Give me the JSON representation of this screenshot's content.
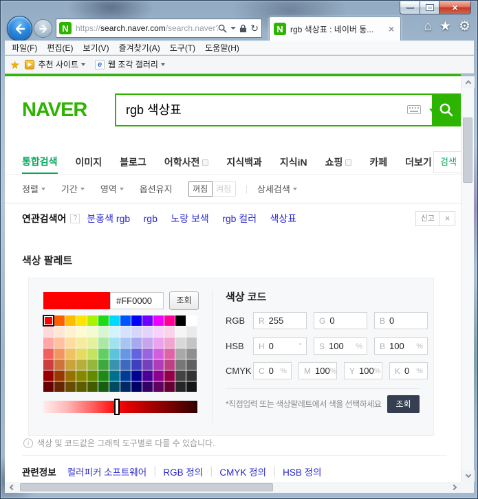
{
  "browser": {
    "tab_title": "rgb 색상표 : 네이버 통...",
    "favicon_letter": "N",
    "url": {
      "scheme": "https://",
      "host": "search.naver.com",
      "path": "/search.naver?"
    }
  },
  "menu": {
    "items": [
      "파일(F)",
      "편집(E)",
      "보기(V)",
      "즐겨찾기(A)",
      "도구(T)",
      "도움말(H)"
    ]
  },
  "favbar": {
    "suggested_sites": "추천 사이트",
    "web_slices": "웹 조각 갤러리"
  },
  "header": {
    "logo": "NAVER",
    "query": "rgb 색상표"
  },
  "tabs": {
    "items": [
      "통합검색",
      "이미지",
      "블로그",
      "어학사전",
      "지식백과",
      "지식iN",
      "쇼핑",
      "카페",
      "더보기"
    ],
    "active": "통합검색",
    "side_button": "검색"
  },
  "filters": {
    "sort": "정렬",
    "period": "기간",
    "scope": "영역",
    "keep_option": "옵션유지",
    "off": "꺼짐",
    "on": "켜짐",
    "advanced": "상세검색"
  },
  "related": {
    "label": "연관검색어",
    "help": "?",
    "terms": [
      "분홍색 rgb",
      "rgb",
      "노랑 보색",
      "rgb 컬러",
      "색상표"
    ],
    "report": "신고"
  },
  "palette": {
    "section_title": "색상 팔레트",
    "hex": "#FF0000",
    "lookup": "조회",
    "selected_row": 0,
    "selected_col": 0,
    "slider_pct": 48,
    "grid": [
      [
        "#FF0000",
        "#FF5E00",
        "#FFBB00",
        "#FFE400",
        "#ABF200",
        "#1DDB16",
        "#00D8FF",
        "#0054FF",
        "#0100FF",
        "#6F00FF",
        "#EB00FF",
        "#FF0095",
        "#000000",
        "#FFFFFF"
      ],
      [
        "#FFD8D8",
        "#FFE6D5",
        "#FFF2D1",
        "#FFFBD1",
        "#F2FBD1",
        "#D8F5D2",
        "#D2F3FB",
        "#D4E3FB",
        "#D6D6FB",
        "#E3D4FB",
        "#F7D2FB",
        "#FBD2EA",
        "#F5F5F5",
        "#EAEAEA"
      ],
      [
        "#FFA7A7",
        "#FFC19E",
        "#FFDD9E",
        "#F7EC9E",
        "#E4F29C",
        "#ACE8A5",
        "#A2E2EF",
        "#A8C4F0",
        "#A8A8F0",
        "#C6A4EE",
        "#EBA2EF",
        "#F0A4CE",
        "#D8D8D8",
        "#C4C4C4"
      ],
      [
        "#F15F5F",
        "#F29661",
        "#F2C161",
        "#E6DB5F",
        "#C4E45E",
        "#62CF62",
        "#5BC4DC",
        "#6597E2",
        "#6464E0",
        "#9A64DE",
        "#D25FDD",
        "#DE64A6",
        "#A8A8A8",
        "#8F8F8F"
      ],
      [
        "#CC3D3D",
        "#CC7439",
        "#CCA23A",
        "#B8AE3A",
        "#93B83A",
        "#3DA93D",
        "#3A93AD",
        "#3F69C0",
        "#4040BE",
        "#7540BC",
        "#B03BB8",
        "#BC4084",
        "#777777",
        "#606060"
      ],
      [
        "#980000",
        "#973800",
        "#977200",
        "#888800",
        "#648A00",
        "#1E8A16",
        "#00708E",
        "#003C93",
        "#000093",
        "#4B0095",
        "#8E008E",
        "#930049",
        "#434343",
        "#333333"
      ],
      [
        "#670000",
        "#662600",
        "#664D00",
        "#5C5C00",
        "#445C00",
        "#175E10",
        "#004B60",
        "#002865",
        "#000065",
        "#330066",
        "#600060",
        "#650032",
        "#262626",
        "#161616"
      ]
    ]
  },
  "code": {
    "title": "색상 코드",
    "rgb_label": "RGB",
    "rgb": [
      {
        "p": "R",
        "v": "255",
        "u": ""
      },
      {
        "p": "G",
        "v": "0",
        "u": ""
      },
      {
        "p": "B",
        "v": "0",
        "u": ""
      }
    ],
    "hsb_label": "HSB",
    "hsb": [
      {
        "p": "H",
        "v": "0",
        "u": "°"
      },
      {
        "p": "S",
        "v": "100",
        "u": "%"
      },
      {
        "p": "B",
        "v": "100",
        "u": "%"
      }
    ],
    "cmyk_label": "CMYK",
    "cmyk": [
      {
        "p": "C",
        "v": "0",
        "u": "%"
      },
      {
        "p": "M",
        "v": "100",
        "u": "%"
      },
      {
        "p": "Y",
        "v": "100",
        "u": "%"
      },
      {
        "p": "K",
        "v": "0",
        "u": "%"
      }
    ],
    "note": "*직접입력 또는 색상팔레트에서 색을 선택하세요",
    "submit": "조회"
  },
  "footer": {
    "info": "색상 및 코드값은 그래픽 도구별로 다를 수 있습니다.",
    "related_label": "관련정보",
    "links": [
      "컬러피커 소프트웨어",
      "RGB 정의",
      "CMYK 정의",
      "HSB 정의"
    ]
  },
  "colors": {
    "naver_green": "#2DB400",
    "active_tab_green": "#03A95C",
    "link_blue": "#2A2AD0",
    "swatch_red": "#FF0000",
    "submit_navy": "#353F51"
  }
}
